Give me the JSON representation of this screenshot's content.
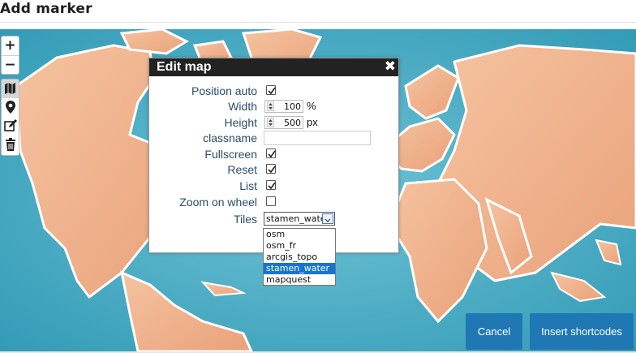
{
  "page": {
    "title": "Add marker"
  },
  "zoom": {
    "in_label": "+",
    "out_label": "−"
  },
  "dialog": {
    "title": "Edit map",
    "close_label": "✖",
    "fields": {
      "position_auto": {
        "label": "Position auto",
        "checked": true
      },
      "width": {
        "label": "Width",
        "value": "100",
        "unit": "%"
      },
      "height": {
        "label": "Height",
        "value": "500",
        "unit": "px"
      },
      "classname": {
        "label": "classname",
        "value": ""
      },
      "fullscreen": {
        "label": "Fullscreen",
        "checked": true
      },
      "reset": {
        "label": "Reset",
        "checked": true
      },
      "list": {
        "label": "List",
        "checked": true
      },
      "zoom_on_wheel": {
        "label": "Zoom on wheel",
        "checked": false
      },
      "tiles": {
        "label": "Tiles",
        "value": "stamen_water"
      }
    }
  },
  "tiles_options": [
    {
      "label": "osm",
      "selected": false
    },
    {
      "label": "osm_fr",
      "selected": false
    },
    {
      "label": "arcgis_topo",
      "selected": false
    },
    {
      "label": "stamen_water",
      "selected": true
    },
    {
      "label": "mapquest",
      "selected": false
    }
  ],
  "buttons": {
    "cancel": "Cancel",
    "insert": "Insert shortcodes"
  },
  "colors": {
    "ocean": "#3fa6c0",
    "land": "#f0b48e",
    "button": "#1f78b4",
    "selected_option": "#1874d1"
  }
}
